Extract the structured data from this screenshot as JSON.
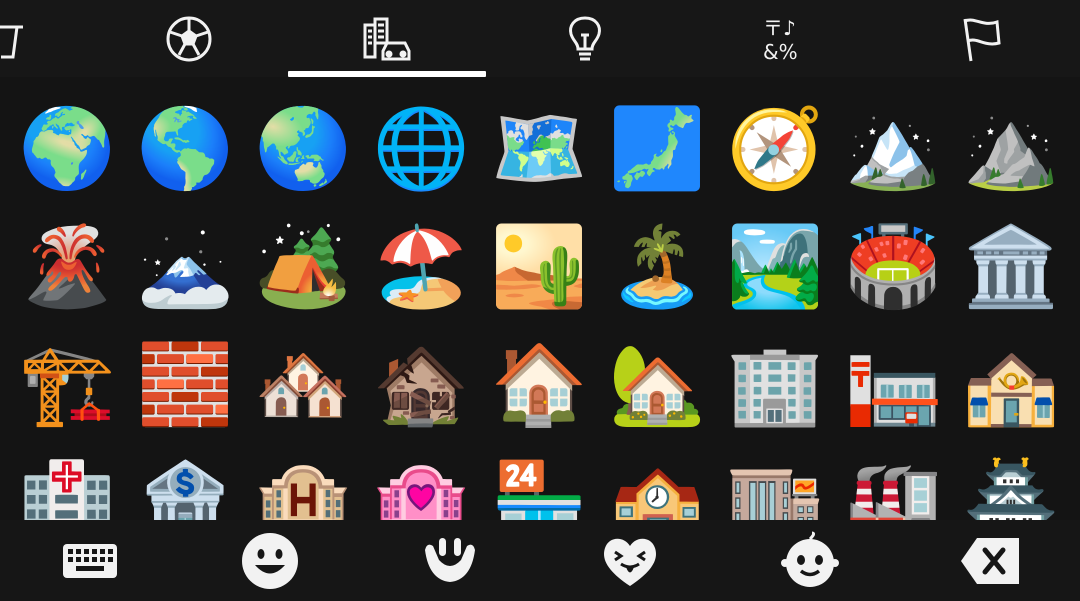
{
  "category_tabs": [
    {
      "icon": "cup-icon",
      "selected": false
    },
    {
      "icon": "soccer-ball-icon",
      "selected": false
    },
    {
      "icon": "buildings-car-icon",
      "selected": true
    },
    {
      "icon": "lightbulb-icon",
      "selected": false
    },
    {
      "icon": "symbols-icon",
      "selected": false,
      "glyphs": "〒♪\n&%"
    },
    {
      "icon": "flag-icon",
      "selected": false
    }
  ],
  "emoji_grid": {
    "rows": [
      [
        "🌍",
        "🌎",
        "🌏",
        "🌐",
        "🗺️",
        "🗾",
        "🧭",
        "🏔️",
        "⛰️"
      ],
      [
        "🌋",
        "🗻",
        "🏕️",
        "🏖️",
        "🏜️",
        "🏝️",
        "🏞️",
        "🏟️",
        "🏛️"
      ],
      [
        "🏗️",
        "🧱",
        "🏘️",
        "🏚️",
        "🏠",
        "🏡",
        "🏢",
        "🏣",
        "🏤"
      ],
      [
        "🏥",
        "🏦",
        "🏨",
        "🏩",
        "🏪",
        "🏫",
        "🏬",
        "🏭",
        "🏯"
      ]
    ]
  },
  "bottom_bar": {
    "buttons": [
      {
        "icon": "keyboard-icon"
      },
      {
        "icon": "smiley-icon"
      },
      {
        "icon": "hand-gesture-icon"
      },
      {
        "icon": "heart-face-icon"
      },
      {
        "icon": "baby-face-icon"
      },
      {
        "icon": "backspace-icon"
      }
    ]
  }
}
